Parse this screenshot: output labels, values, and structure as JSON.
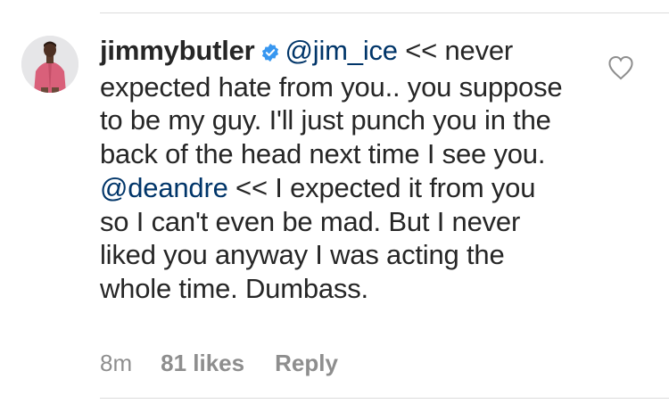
{
  "comment": {
    "username": "jimmybutler",
    "verified_badge_icon": "verified-badge-icon",
    "segments": [
      {
        "type": "mention",
        "text": "@jim_ice"
      },
      {
        "type": "text",
        "text": " << never expected hate from you.. you suppose to be my guy. I'll just punch you in the back of the head next time I see you. "
      },
      {
        "type": "mention",
        "text": "@deandre"
      },
      {
        "type": "text",
        "text": " << I expected it from you so I can't even be mad. But I never liked you anyway I was acting the whole time. Dumbass."
      }
    ]
  },
  "meta": {
    "time": "8m",
    "likes": "81 likes",
    "reply_label": "Reply"
  },
  "icons": {
    "like": "heart-outline-icon",
    "avatar": "profile-avatar"
  },
  "colors": {
    "text": "#262626",
    "mention": "#003569",
    "meta": "#8e8e8e",
    "verified": "#3897f0",
    "divider": "#dbdbdb"
  }
}
